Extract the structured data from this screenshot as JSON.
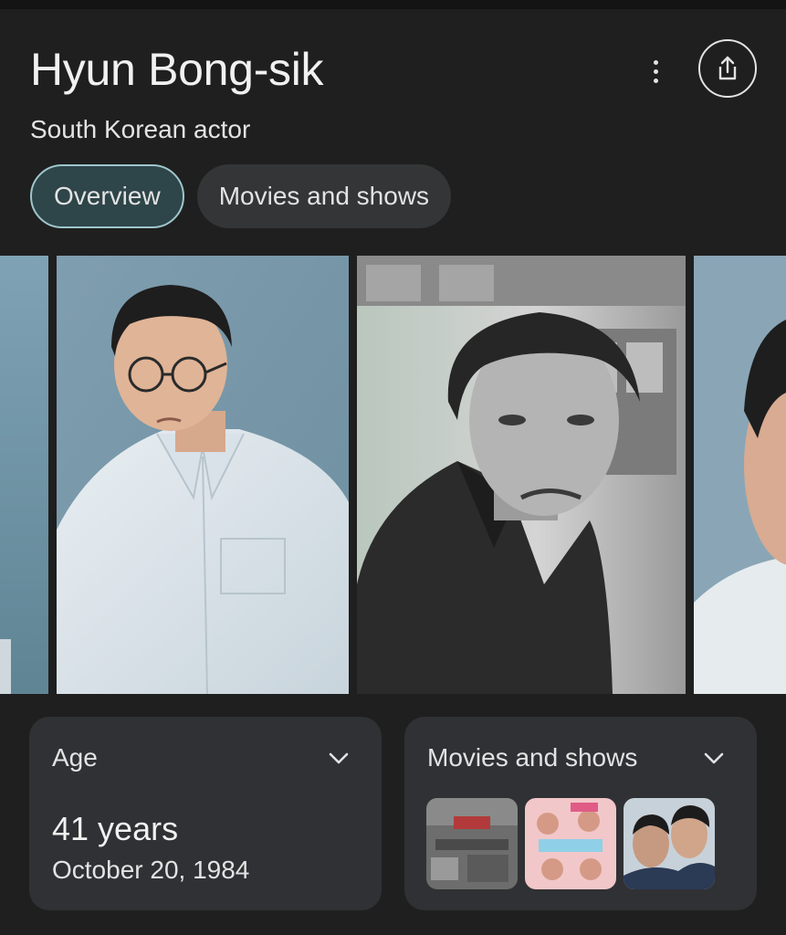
{
  "header": {
    "title": "Hyun Bong-sik",
    "subtitle": "South Korean actor"
  },
  "tabs": [
    {
      "label": "Overview",
      "active": true
    },
    {
      "label": "Movies and shows",
      "active": false
    }
  ],
  "cards": {
    "age": {
      "label": "Age",
      "value": "41 years",
      "date": "October 20, 1984"
    },
    "movies": {
      "label": "Movies and shows"
    }
  },
  "colors": {
    "background": "#1f1f1f",
    "card": "#303134",
    "active_chip_fill": "#2e4549",
    "active_chip_border": "#9fc6cc"
  }
}
